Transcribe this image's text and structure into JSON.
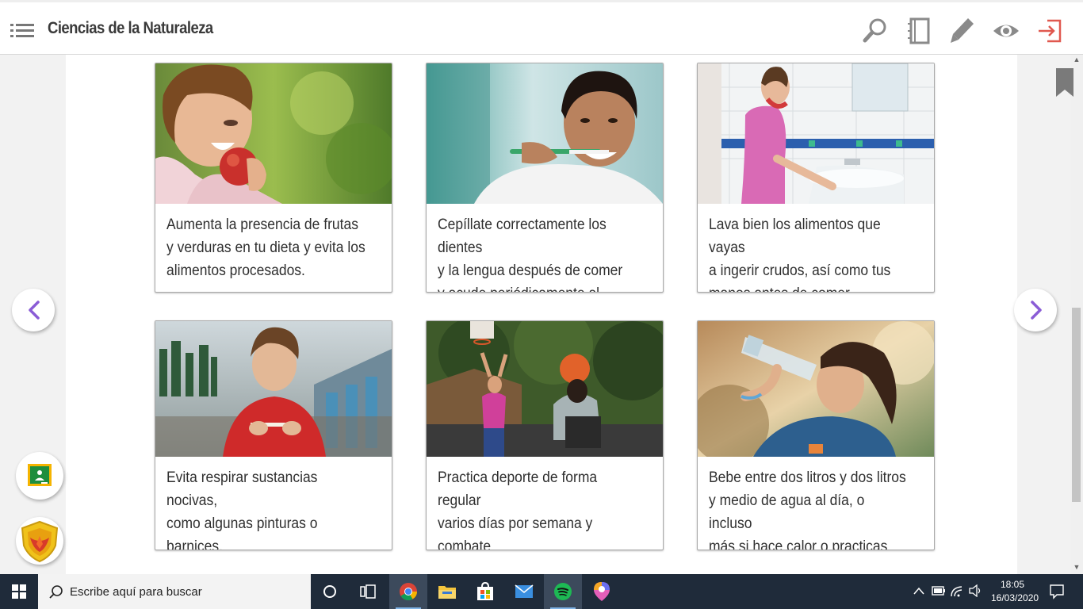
{
  "header": {
    "title": "Ciencias de la Naturaleza",
    "buttons": [
      "search-icon",
      "notebook-icon",
      "pencil-icon",
      "eye-icon",
      "exit-icon"
    ]
  },
  "cards": [
    {
      "text": "Aumenta la presencia de frutas\ny verduras en tu dieta y evita los\nalimentos procesados."
    },
    {
      "text": "Cepíllate correctamente los dientes\ny la lengua después de comer\ny acude periódicamente al dentista."
    },
    {
      "text": "Lava bien los alimentos que vayas\na ingerir crudos, así como tus\nmanos antes de comer."
    },
    {
      "text": "Evita respirar sustancias nocivas,\ncomo algunas pinturas o barnices,\ny consumir tabaco y alcohol."
    },
    {
      "text": "Practica deporte de forma regular\nvarios días por semana y combate\nla vida sedentaria e inactiva."
    },
    {
      "text": "Bebe entre dos litros y dos litros\ny medio de agua al día, o incluso\nmás si hace calor o practicas deporte."
    }
  ],
  "taskbar": {
    "search_text": "Escribe aquí para buscar",
    "time": "18:05",
    "date": "16/03/2020"
  },
  "colors": {
    "accent_purple": "#8a5cd6",
    "exit_red": "#e0584f",
    "taskbar": "#1f2b3a"
  }
}
